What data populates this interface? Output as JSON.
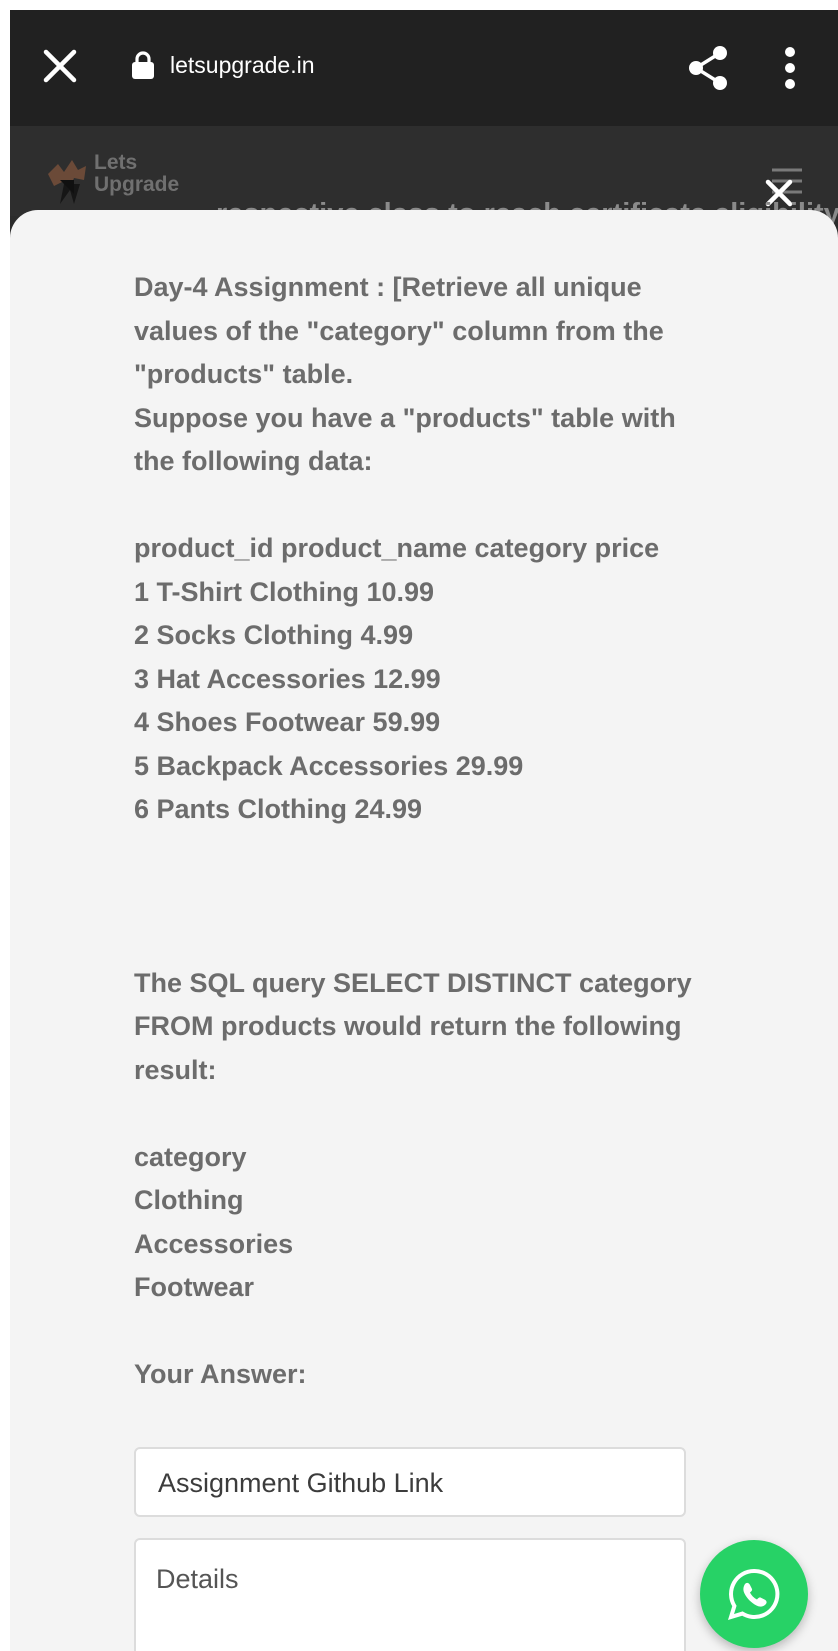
{
  "browser": {
    "url": "letsupgrade.in"
  },
  "site": {
    "logo_line1": "Lets",
    "logo_line2": "Upgrade",
    "peek_text": "respective class to reach certificate eligibility"
  },
  "assignment": {
    "intro_lines": [
      "Day-4 Assignment : [Retrieve all unique",
      "values of the \"category\" column from the",
      "\"products\" table.",
      "Suppose you have a \"products\" table with",
      "the following data:"
    ],
    "table_header": "product_id product_name category price",
    "table_rows": [
      "1 T-Shirt Clothing 10.99",
      "2 Socks Clothing 4.99",
      "3 Hat Accessories 12.99",
      "4 Shoes Footwear 59.99",
      "5 Backpack Accessories 29.99",
      "6 Pants Clothing 24.99"
    ],
    "query_lines": [
      "The SQL query SELECT DISTINCT category",
      "FROM products would return the following",
      "result:"
    ],
    "result_lines": [
      "category",
      "Clothing",
      "Accessories",
      "Footwear"
    ]
  },
  "form": {
    "answer_label": "Your Answer:",
    "link_placeholder": "Assignment Github Link",
    "details_placeholder": "Details"
  },
  "colors": {
    "browser_bar": "#212121",
    "sheet": "#f4f4f4",
    "text": "#6c6c6c",
    "whatsapp": "#27d266"
  }
}
